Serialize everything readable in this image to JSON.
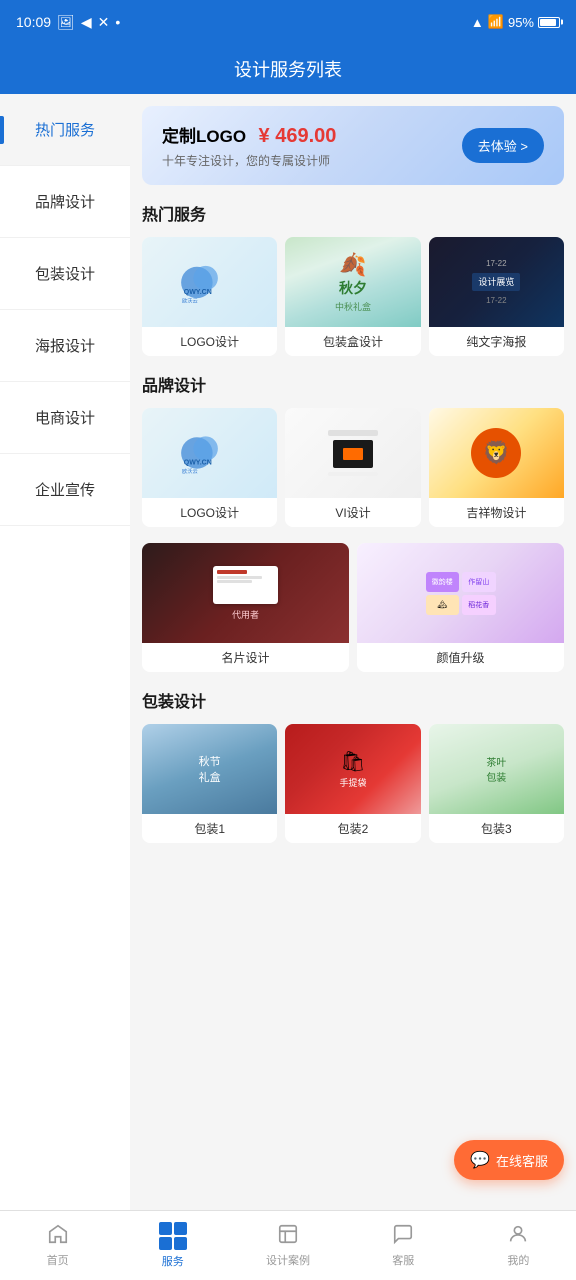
{
  "statusBar": {
    "time": "10:09",
    "battery": "95%"
  },
  "header": {
    "title": "设计服务列表"
  },
  "sidebar": {
    "items": [
      {
        "id": "hot",
        "label": "热门服务",
        "active": true
      },
      {
        "id": "brand",
        "label": "品牌设计",
        "active": false
      },
      {
        "id": "packaging",
        "label": "包装设计",
        "active": false
      },
      {
        "id": "poster",
        "label": "海报设计",
        "active": false
      },
      {
        "id": "ecommerce",
        "label": "电商设计",
        "active": false
      },
      {
        "id": "corporate",
        "label": "企业宣传",
        "active": false
      }
    ]
  },
  "banner": {
    "tag": "定制LOGO",
    "price": "¥ 469.00",
    "subtitle": "十年专注设计，您的专属设计师",
    "btnLabel": "去体验 >"
  },
  "hotServices": {
    "sectionTitle": "热门服务",
    "items": [
      {
        "label": "LOGO设计",
        "thumb": "logo"
      },
      {
        "label": "包装盒设计",
        "thumb": "packaging"
      },
      {
        "label": "纯文字海报",
        "thumb": "poster"
      }
    ]
  },
  "brandServices": {
    "sectionTitle": "品牌设计",
    "items": [
      {
        "label": "LOGO设计",
        "thumb": "logo"
      },
      {
        "label": "VI设计",
        "thumb": "vi"
      },
      {
        "label": "吉祥物设计",
        "thumb": "mascot"
      },
      {
        "label": "名片设计",
        "thumb": "card"
      },
      {
        "label": "颜值升级",
        "thumb": "value"
      }
    ]
  },
  "packagingServices": {
    "sectionTitle": "包装设计",
    "items": [
      {
        "label": "包装1",
        "thumb": "pack2"
      },
      {
        "label": "包装2",
        "thumb": "pack3"
      },
      {
        "label": "包装3",
        "thumb": "pack4"
      }
    ]
  },
  "floatBtn": {
    "label": "在线客服"
  },
  "bottomNav": {
    "items": [
      {
        "id": "home",
        "label": "首页",
        "icon": "home",
        "active": false
      },
      {
        "id": "service",
        "label": "服务",
        "icon": "service",
        "active": true
      },
      {
        "id": "cases",
        "label": "设计案例",
        "icon": "cases",
        "active": false
      },
      {
        "id": "customer",
        "label": "客服",
        "icon": "customer",
        "active": false
      },
      {
        "id": "mine",
        "label": "我的",
        "icon": "mine",
        "active": false
      }
    ]
  }
}
